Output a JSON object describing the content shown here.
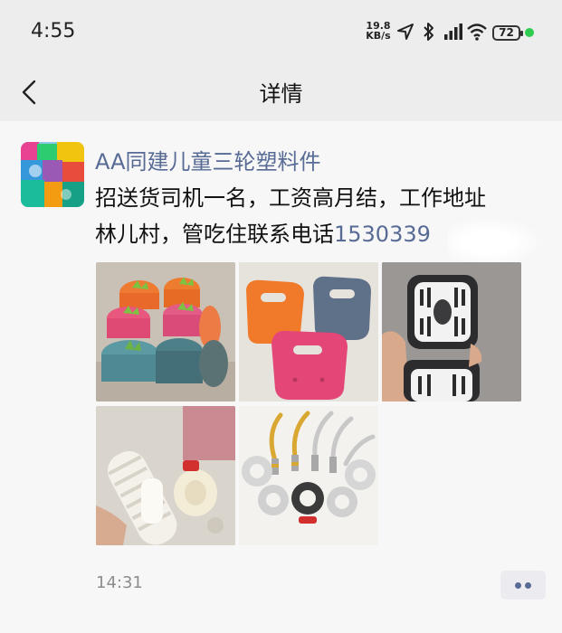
{
  "status_bar": {
    "time": "4:55",
    "network_speed_value": "19.8",
    "network_speed_unit": "KB/s",
    "battery": "72",
    "icons": [
      "location-arrow-icon",
      "bluetooth-icon",
      "signal-bars-icon",
      "wifi-icon",
      "battery-icon",
      "active-dot-icon"
    ]
  },
  "nav": {
    "title": "详情",
    "back_icon": "chevron-left-icon"
  },
  "post": {
    "author": "AA同建儿童三轮塑料件",
    "text_line1": "招送货司机一名，工资高月结，工作地址",
    "text_line2_prefix": "林儿村，管吃住联系电话",
    "phone_visible": "1530339",
    "timestamp": "14:31",
    "more_icon": "more-dots-icon",
    "images": [
      "silicone storage buckets",
      "plastic child seats",
      "plastic speaker grille part",
      "white plastic rollers",
      "metal hooks and rings"
    ]
  },
  "colors": {
    "link": "#576b95",
    "header_bg": "#ededed",
    "page_bg": "#f7f7f7",
    "status_dot": "#2ecc4f"
  }
}
